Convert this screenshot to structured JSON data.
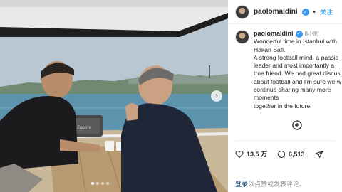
{
  "post": {
    "username": "paolomaldini",
    "follow_separator": "•",
    "follow_label": "关注",
    "time_ago": "8小时",
    "caption_lines": [
      "Wonderful time in Istanbul with",
      "Hakan Safi.",
      "A strong football mind, a passio",
      "leader and most importantly a",
      "true friend. We had great discus",
      "about football and I'm sure we w",
      "continue sharing many more",
      "moments",
      "together in the future"
    ],
    "likes": "13.5 万",
    "comments": "6,513",
    "login_link": "登录",
    "login_rest": "以点赞或发表评论。"
  },
  "photo": {
    "boat_name": "Zuccon",
    "carousel_dots": 4,
    "active_dot": 0
  },
  "icons": {
    "verified": "verified-badge-icon",
    "more": "plus-circle-icon",
    "like": "heart-icon",
    "comment": "comment-bubble-icon",
    "share": "paper-plane-icon",
    "next": "chevron-right-icon"
  },
  "colors": {
    "accent": "#0095f6",
    "verified": "#3897f0",
    "link": "#00376b",
    "muted": "#8e8e8e"
  }
}
